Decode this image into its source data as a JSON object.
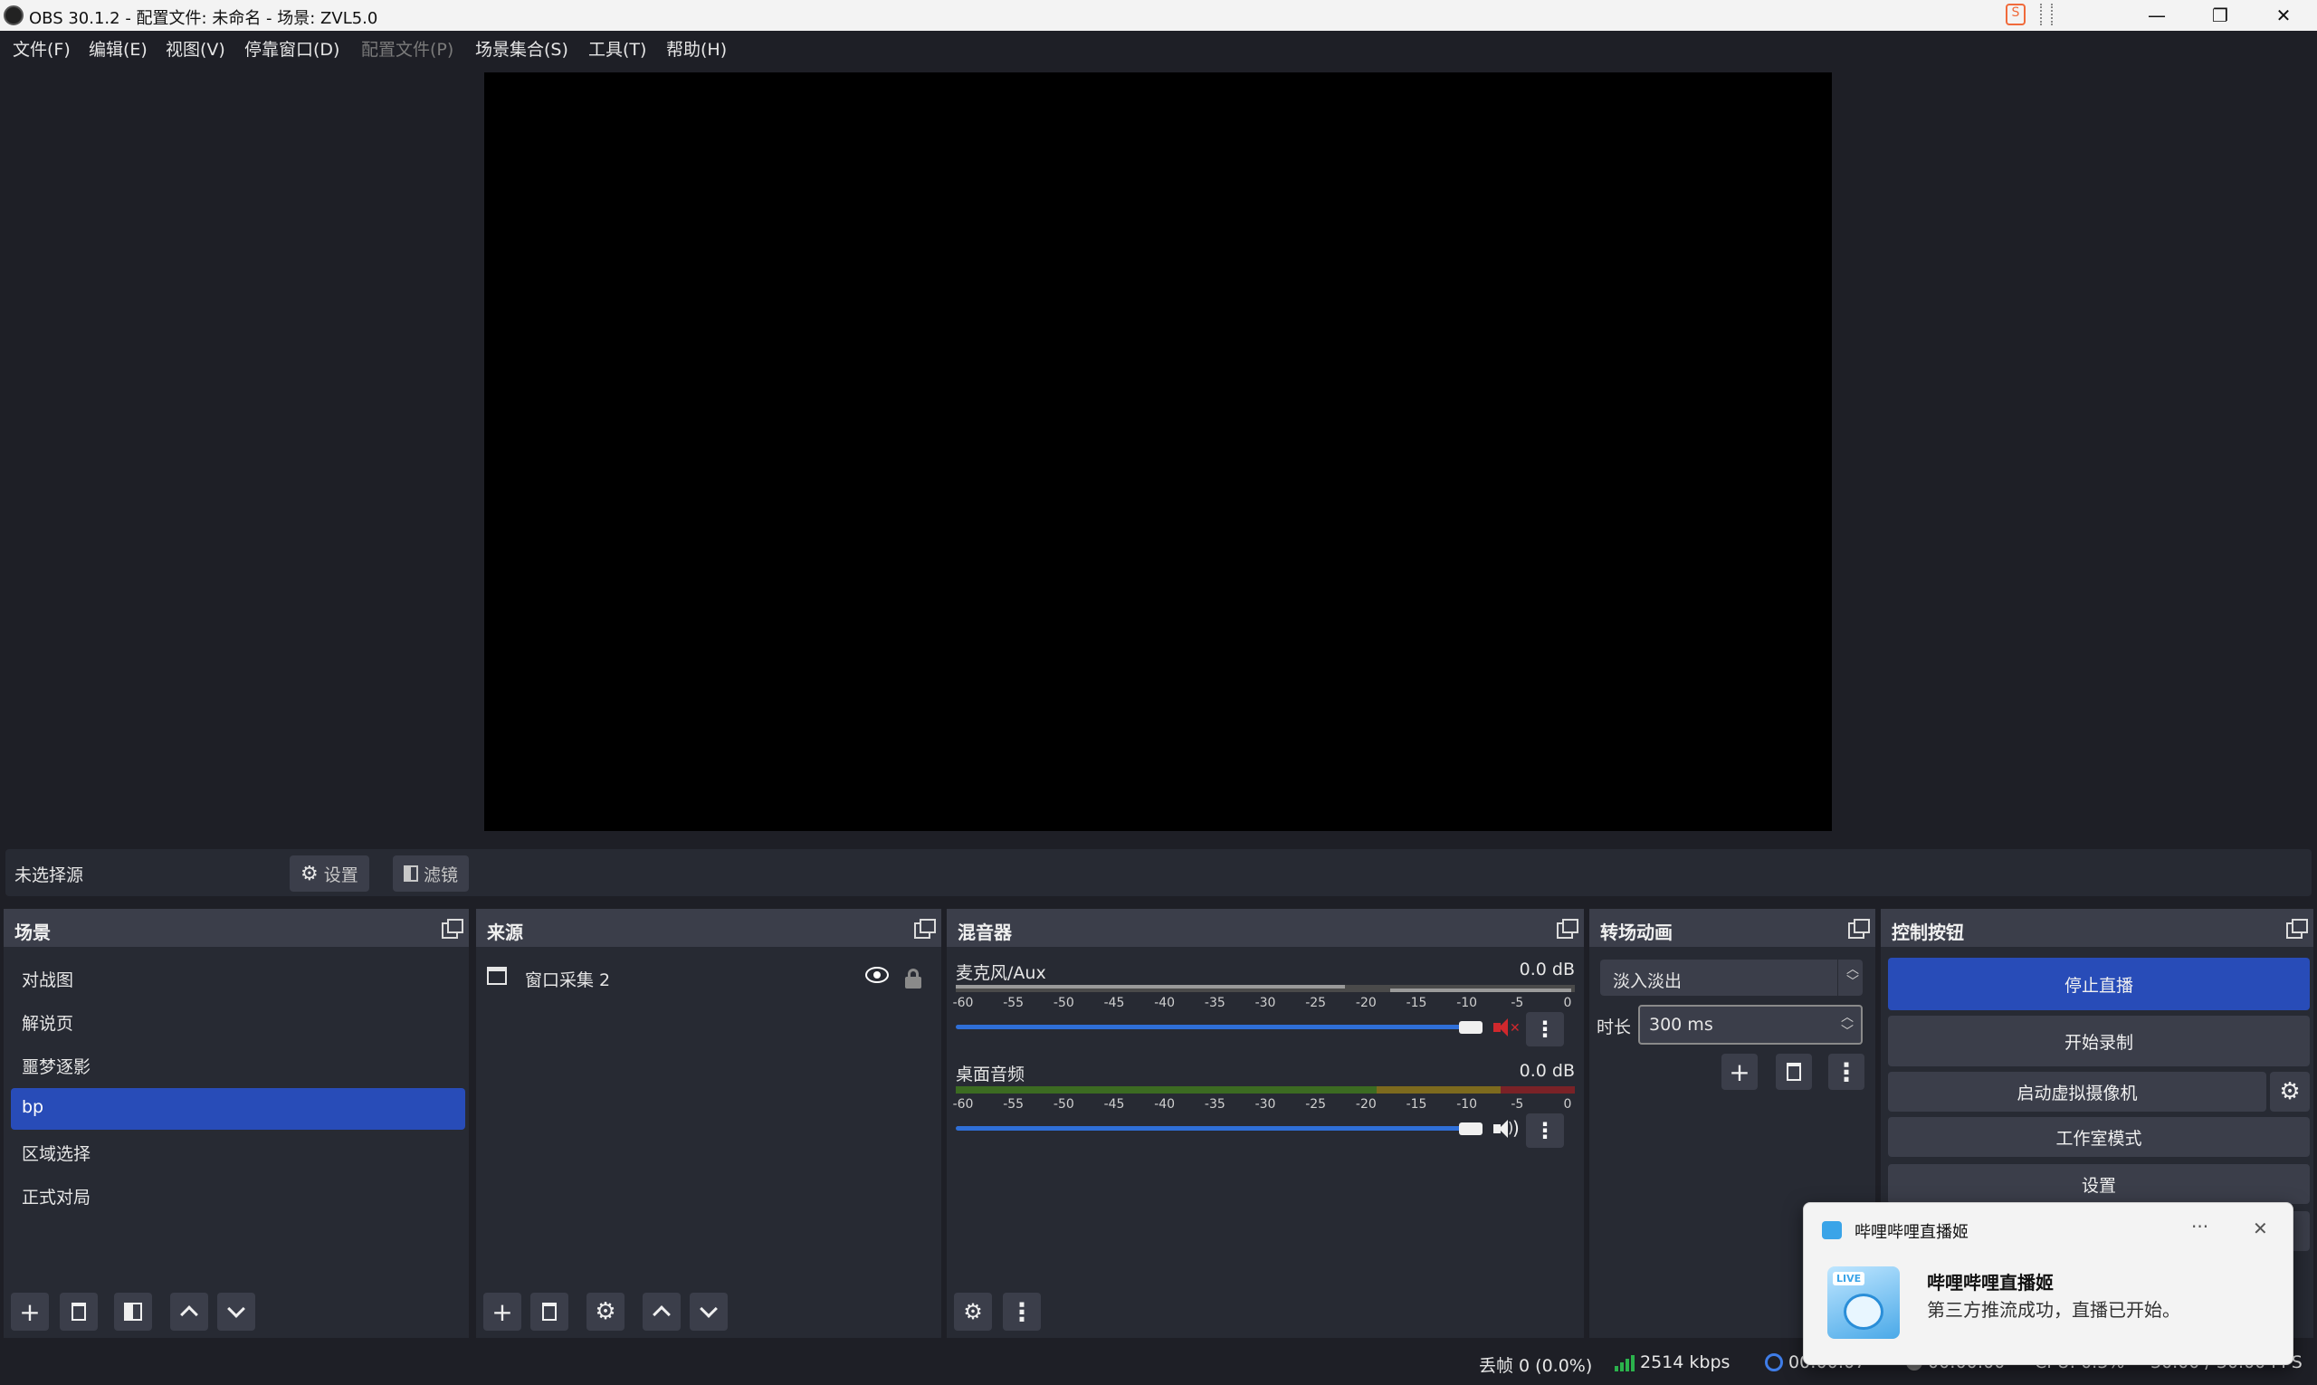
{
  "window": {
    "title": "OBS 30.1.2 - 配置文件: 未命名 - 场景: ZVL5.0",
    "min_label": "—",
    "max_label": "❐",
    "close_label": "✕"
  },
  "menu": [
    {
      "label": "文件(F)",
      "disabled": false
    },
    {
      "label": "编辑(E)",
      "disabled": false
    },
    {
      "label": "视图(V)",
      "disabled": false
    },
    {
      "label": "停靠窗口(D)",
      "disabled": false
    },
    {
      "label": "配置文件(P)",
      "disabled": true
    },
    {
      "label": "场景集合(S)",
      "disabled": false
    },
    {
      "label": "工具(T)",
      "disabled": false
    },
    {
      "label": "帮助(H)",
      "disabled": false
    }
  ],
  "context_bar": {
    "no_source_label": "未选择源",
    "settings_label": "设置",
    "filters_label": "滤镜"
  },
  "scenes": {
    "title": "场景",
    "items": [
      "对战图",
      "解说页",
      "噩梦逐影",
      "bp",
      "区域选择",
      "正式对局"
    ],
    "active_index": 3
  },
  "sources": {
    "title": "来源",
    "items": [
      {
        "name": "窗口采集 2",
        "visible": true,
        "locked": true
      }
    ]
  },
  "mixer": {
    "title": "混音器",
    "channels": [
      {
        "name": "麦克风/Aux",
        "db": "0.0 dB",
        "muted": true,
        "volume": 1.0
      },
      {
        "name": "桌面音频",
        "db": "0.0 dB",
        "muted": false,
        "volume": 1.0
      }
    ],
    "scale_labels": [
      "-60",
      "-55",
      "-50",
      "-45",
      "-40",
      "-35",
      "-30",
      "-25",
      "-20",
      "-15",
      "-10",
      "-5",
      "0"
    ]
  },
  "transitions": {
    "title": "转场动画",
    "selected": "淡入淡出",
    "duration_label": "时长",
    "duration_value": "300 ms"
  },
  "controls": {
    "title": "控制按钮",
    "stop_stream": "停止直播",
    "start_record": "开始录制",
    "virtual_cam": "启动虚拟摄像机",
    "studio_mode": "工作室模式",
    "settings": "设置"
  },
  "statusbar": {
    "dropped_frames": "丢帧 0 (0.0%)",
    "bitrate": "2514 kbps",
    "stream_time": "00:00:07",
    "record_time": "00:00:00",
    "cpu": "CPU: 0.3%",
    "fps": "30.00 / 30.00 FPS"
  },
  "toast": {
    "app_name": "哔哩哔哩直播姬",
    "title": "哔哩哔哩直播姬",
    "message": "第三方推流成功，直播已开始。",
    "more_label": "···",
    "close_label": "✕",
    "logo_text": "LIVE"
  },
  "colors": {
    "accent": "#284cb8",
    "stop_stream_bg": "#284cb8",
    "mute_red": "#d0282d"
  }
}
